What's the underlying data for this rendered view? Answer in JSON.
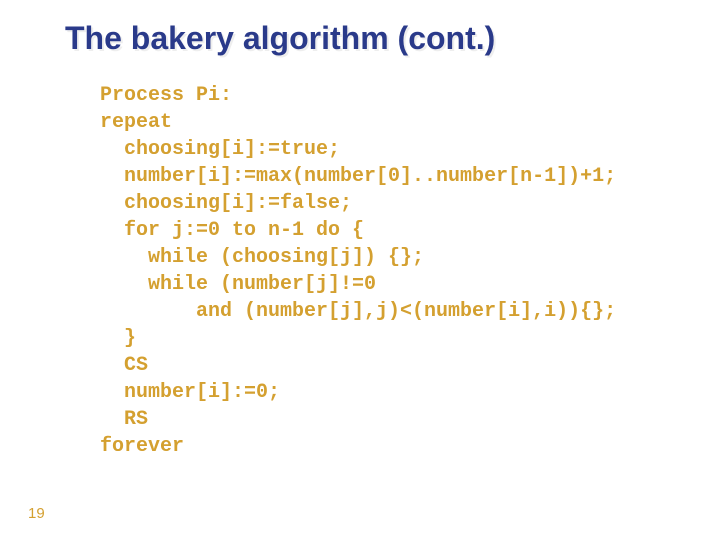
{
  "title": "The bakery algorithm (cont.)",
  "code": {
    "l1": "Process Pi:",
    "l2": "repeat",
    "l3": "  choosing[i]:=true;",
    "l4": "  number[i]:=max(number[0]..number[n-1])+1;",
    "l5": "  choosing[i]:=false;",
    "l6": "  for j:=0 to n-1 do {",
    "l7": "    while (choosing[j]) {};",
    "l8": "    while (number[j]!=0",
    "l9": "        and (number[j],j)<(number[i],i)){};",
    "l10": "  }",
    "l11": "  CS",
    "l12": "  number[i]:=0;",
    "l13": "  RS",
    "l14": "forever"
  },
  "slide_number": "19"
}
